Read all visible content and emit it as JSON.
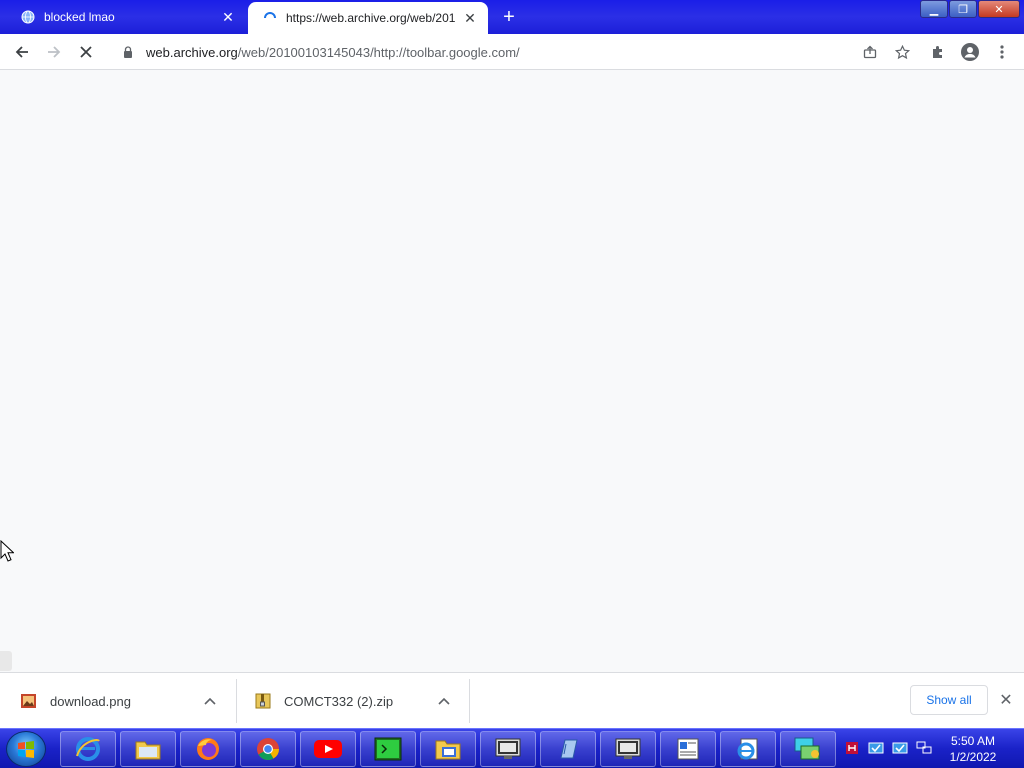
{
  "browser": {
    "tabs": [
      {
        "title": "blocked lmao",
        "active": false,
        "favicon": "globe-icon"
      },
      {
        "title": "https://web.archive.org/web/201",
        "active": true,
        "favicon": "loading-spinner-icon"
      }
    ],
    "new_tab_label": "+",
    "window_controls": {
      "minimize": "minimize-icon",
      "restore": "restore-icon",
      "close": "close-icon"
    }
  },
  "toolbar": {
    "url_host": "web.archive.org",
    "url_path": "/web/20100103145043/http://toolbar.google.com/",
    "loading": true
  },
  "downloads": {
    "items": [
      {
        "name": "download.png",
        "icon": "image-file-icon"
      },
      {
        "name": "COMCT332 (2).zip",
        "icon": "zip-file-icon"
      }
    ],
    "show_all_label": "Show all"
  },
  "taskbar": {
    "pinned": [
      "internet-explorer-icon",
      "file-explorer-icon",
      "firefox-icon",
      "chrome-icon",
      "youtube-icon",
      "terminal-icon",
      "folder-window-icon",
      "monitor-app-icon",
      "notepad-app-icon",
      "screen-app-icon",
      "text-app-icon",
      "ie-document-icon",
      "network-app-icon"
    ],
    "clock": {
      "time": "5:50 AM",
      "date": "1/2/2022"
    }
  },
  "colors": {
    "titlebar": "#1c1fd8",
    "taskbar": "#1a22c8",
    "link_blue": "#1a73e8"
  }
}
